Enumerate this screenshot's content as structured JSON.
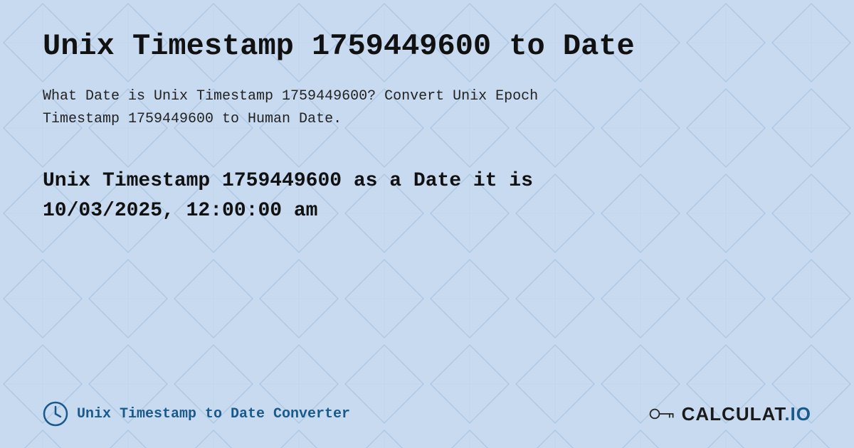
{
  "page": {
    "title": "Unix Timestamp 1759449600 to Date",
    "description_line1": "What Date is Unix Timestamp 1759449600? Convert Unix Epoch",
    "description_line2": "Timestamp 1759449600 to Human Date.",
    "result_line1": "Unix Timestamp 1759449600 as a Date it is",
    "result_line2": "10/03/2025, 12:00:00 am",
    "footer_text": "Unix Timestamp to Date Converter",
    "logo_text": "CALCULAT.IO",
    "bg_color": "#c8daf0",
    "accent_color": "#1a5a8a"
  }
}
